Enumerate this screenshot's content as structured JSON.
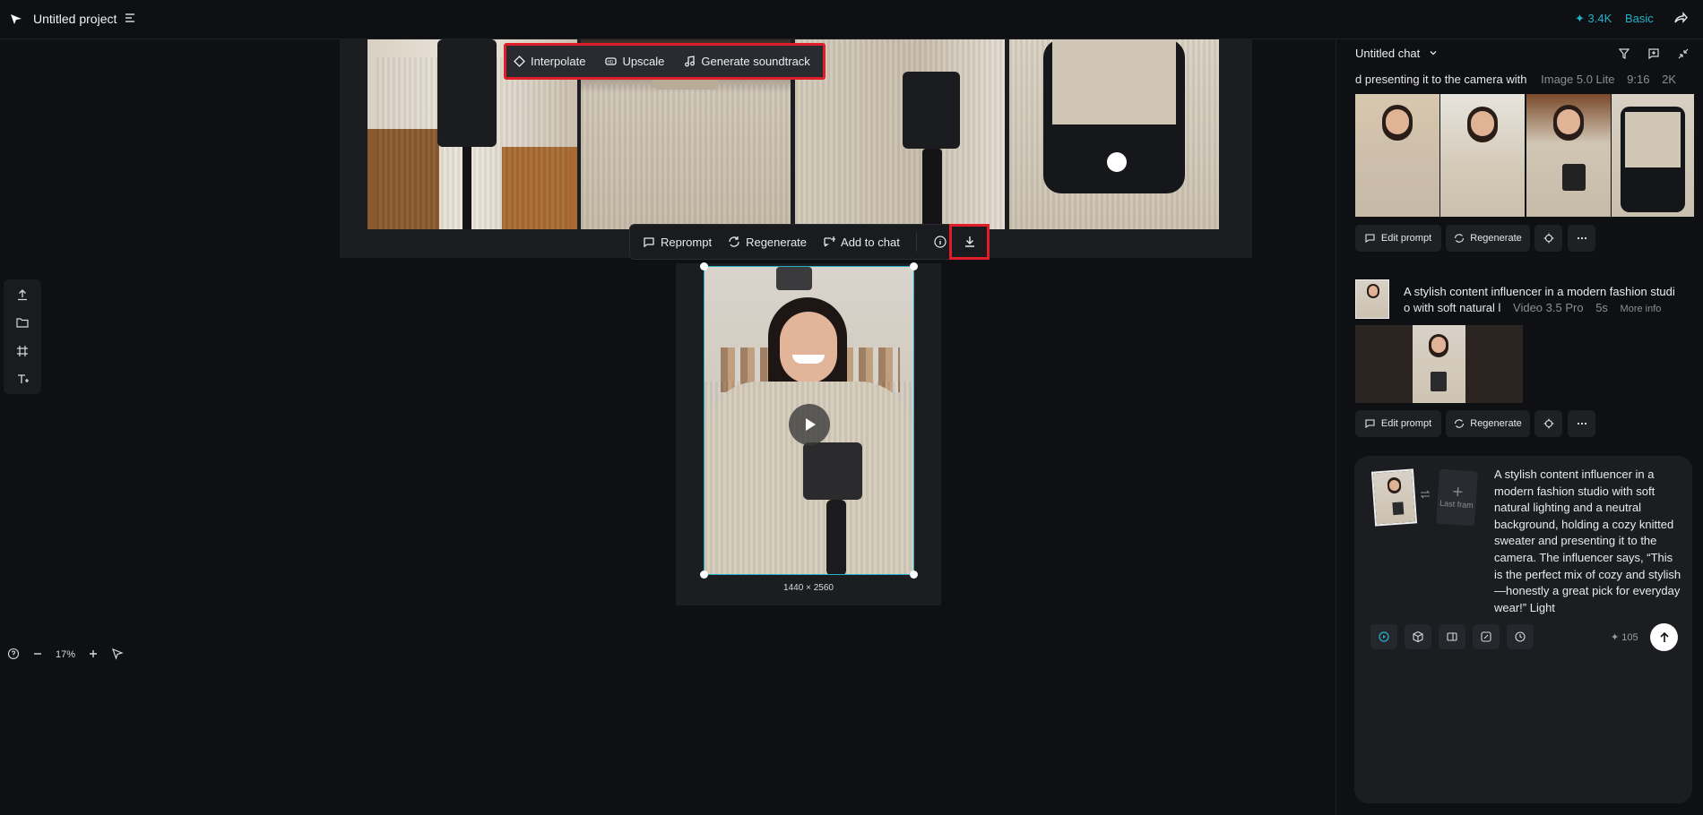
{
  "header": {
    "project_title": "Untitled project",
    "credits": "✦ 3.4K",
    "plan": "Basic"
  },
  "ai_tools": {
    "interpolate": "Interpolate",
    "upscale": "Upscale",
    "soundtrack": "Generate soundtrack"
  },
  "action_bar": {
    "reprompt": "Reprompt",
    "regenerate": "Regenerate",
    "add_to_chat": "Add to chat"
  },
  "video": {
    "dimensions": "1440 × 2560"
  },
  "zoom": {
    "level": "17%"
  },
  "chat": {
    "title": "Untitled chat",
    "first": {
      "prompt": "d presenting it to the camera with",
      "model": "Image 5.0 Lite",
      "ratio": "9:16",
      "quality": "2K",
      "edit_label": "Edit prompt",
      "regen_label": "Regenerate"
    },
    "second": {
      "prompt_line1": "A stylish content influencer in a modern fashion studi",
      "prompt_line2": "o with soft natural l",
      "model": "Video 3.5 Pro",
      "duration": "5s",
      "more_info": "More info",
      "edit_label": "Edit prompt",
      "regen_label": "Regenerate"
    }
  },
  "composer": {
    "last_frame": "Last fram",
    "text": "A stylish content influencer in a modern fashion studio with soft natural lighting and a neutral background, holding a cozy knitted sweater and presenting it to the camera. The influencer says, “This is the perfect mix of cozy and stylish—honestly a great pick for everyday wear!” Light",
    "cost": "✦ 105"
  },
  "colors": {
    "accent": "#24b0c7",
    "highlight": "#e01e2a",
    "background": "#0f1013"
  }
}
